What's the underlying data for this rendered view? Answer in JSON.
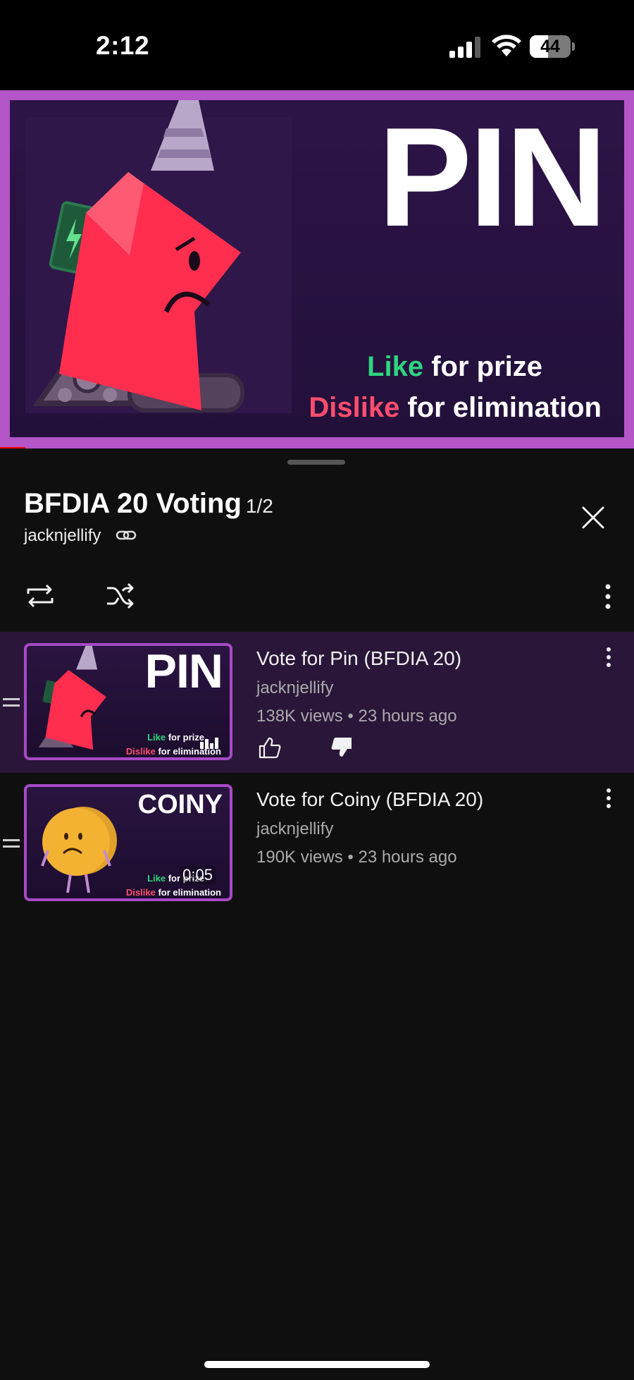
{
  "status_bar": {
    "time": "2:12",
    "battery_level": "44",
    "battery_fraction": 0.44
  },
  "player": {
    "title": "PIN",
    "line1_highlight": "Like",
    "line1_rest": " for prize",
    "line2_highlight": "Dislike",
    "line2_rest": " for elimination",
    "progress_fraction": 0.04
  },
  "playlist": {
    "title": "BFDIA 20 Voting",
    "position": "1/2",
    "owner": "jacknjellify"
  },
  "items": [
    {
      "thumb_title": "PIN",
      "thumb_line1_highlight": "Like",
      "thumb_line1_rest": " for prize",
      "thumb_line2_highlight": "Dislike",
      "thumb_line2_rest": " for elimination",
      "overlay": "",
      "title": "Vote for Pin (BFDIA 20)",
      "channel": "jacknjellify",
      "meta": "138K views • 23 hours ago"
    },
    {
      "thumb_title": "COINY",
      "thumb_line1_highlight": "Like",
      "thumb_line1_rest": " for prize",
      "thumb_line2_highlight": "Dislike",
      "thumb_line2_rest": " for elimination",
      "overlay": "0:05",
      "title": "Vote for Coiny (BFDIA 20)",
      "channel": "jacknjellify",
      "meta": "190K views • 23 hours ago"
    }
  ],
  "colors": {
    "accent_purple": "#b455c8",
    "active_row": "#2a1639",
    "like_green": "#2fd47e",
    "dislike_pink": "#ff4d6d",
    "pin_red": "#ff2e4f"
  }
}
